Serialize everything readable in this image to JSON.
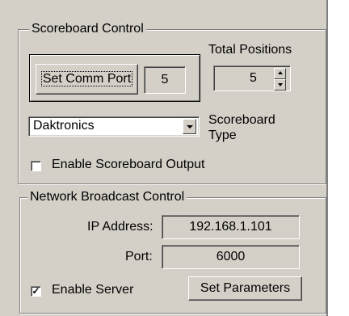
{
  "scoreboard_control": {
    "title": "Scoreboard Control",
    "set_comm_port_label": "Set Comm Port",
    "comm_port_value": "5",
    "total_positions_label": "Total Positions",
    "total_positions_value": "5",
    "scoreboard_type_value": "Daktronics",
    "scoreboard_type_label": "Scoreboard Type",
    "scoreboard_type_label_line1": "Scoreboard",
    "scoreboard_type_label_line2": "Type",
    "enable_output_label": "Enable Scoreboard Output",
    "enable_output_checked": false
  },
  "network_broadcast": {
    "title": "Network Broadcast Control",
    "ip_label": "IP Address:",
    "ip_value": "192.168.1.101",
    "port_label": "Port:",
    "port_value": "6000",
    "enable_server_label": "Enable Server",
    "enable_server_checked": true,
    "set_parameters_label": "Set Parameters"
  }
}
